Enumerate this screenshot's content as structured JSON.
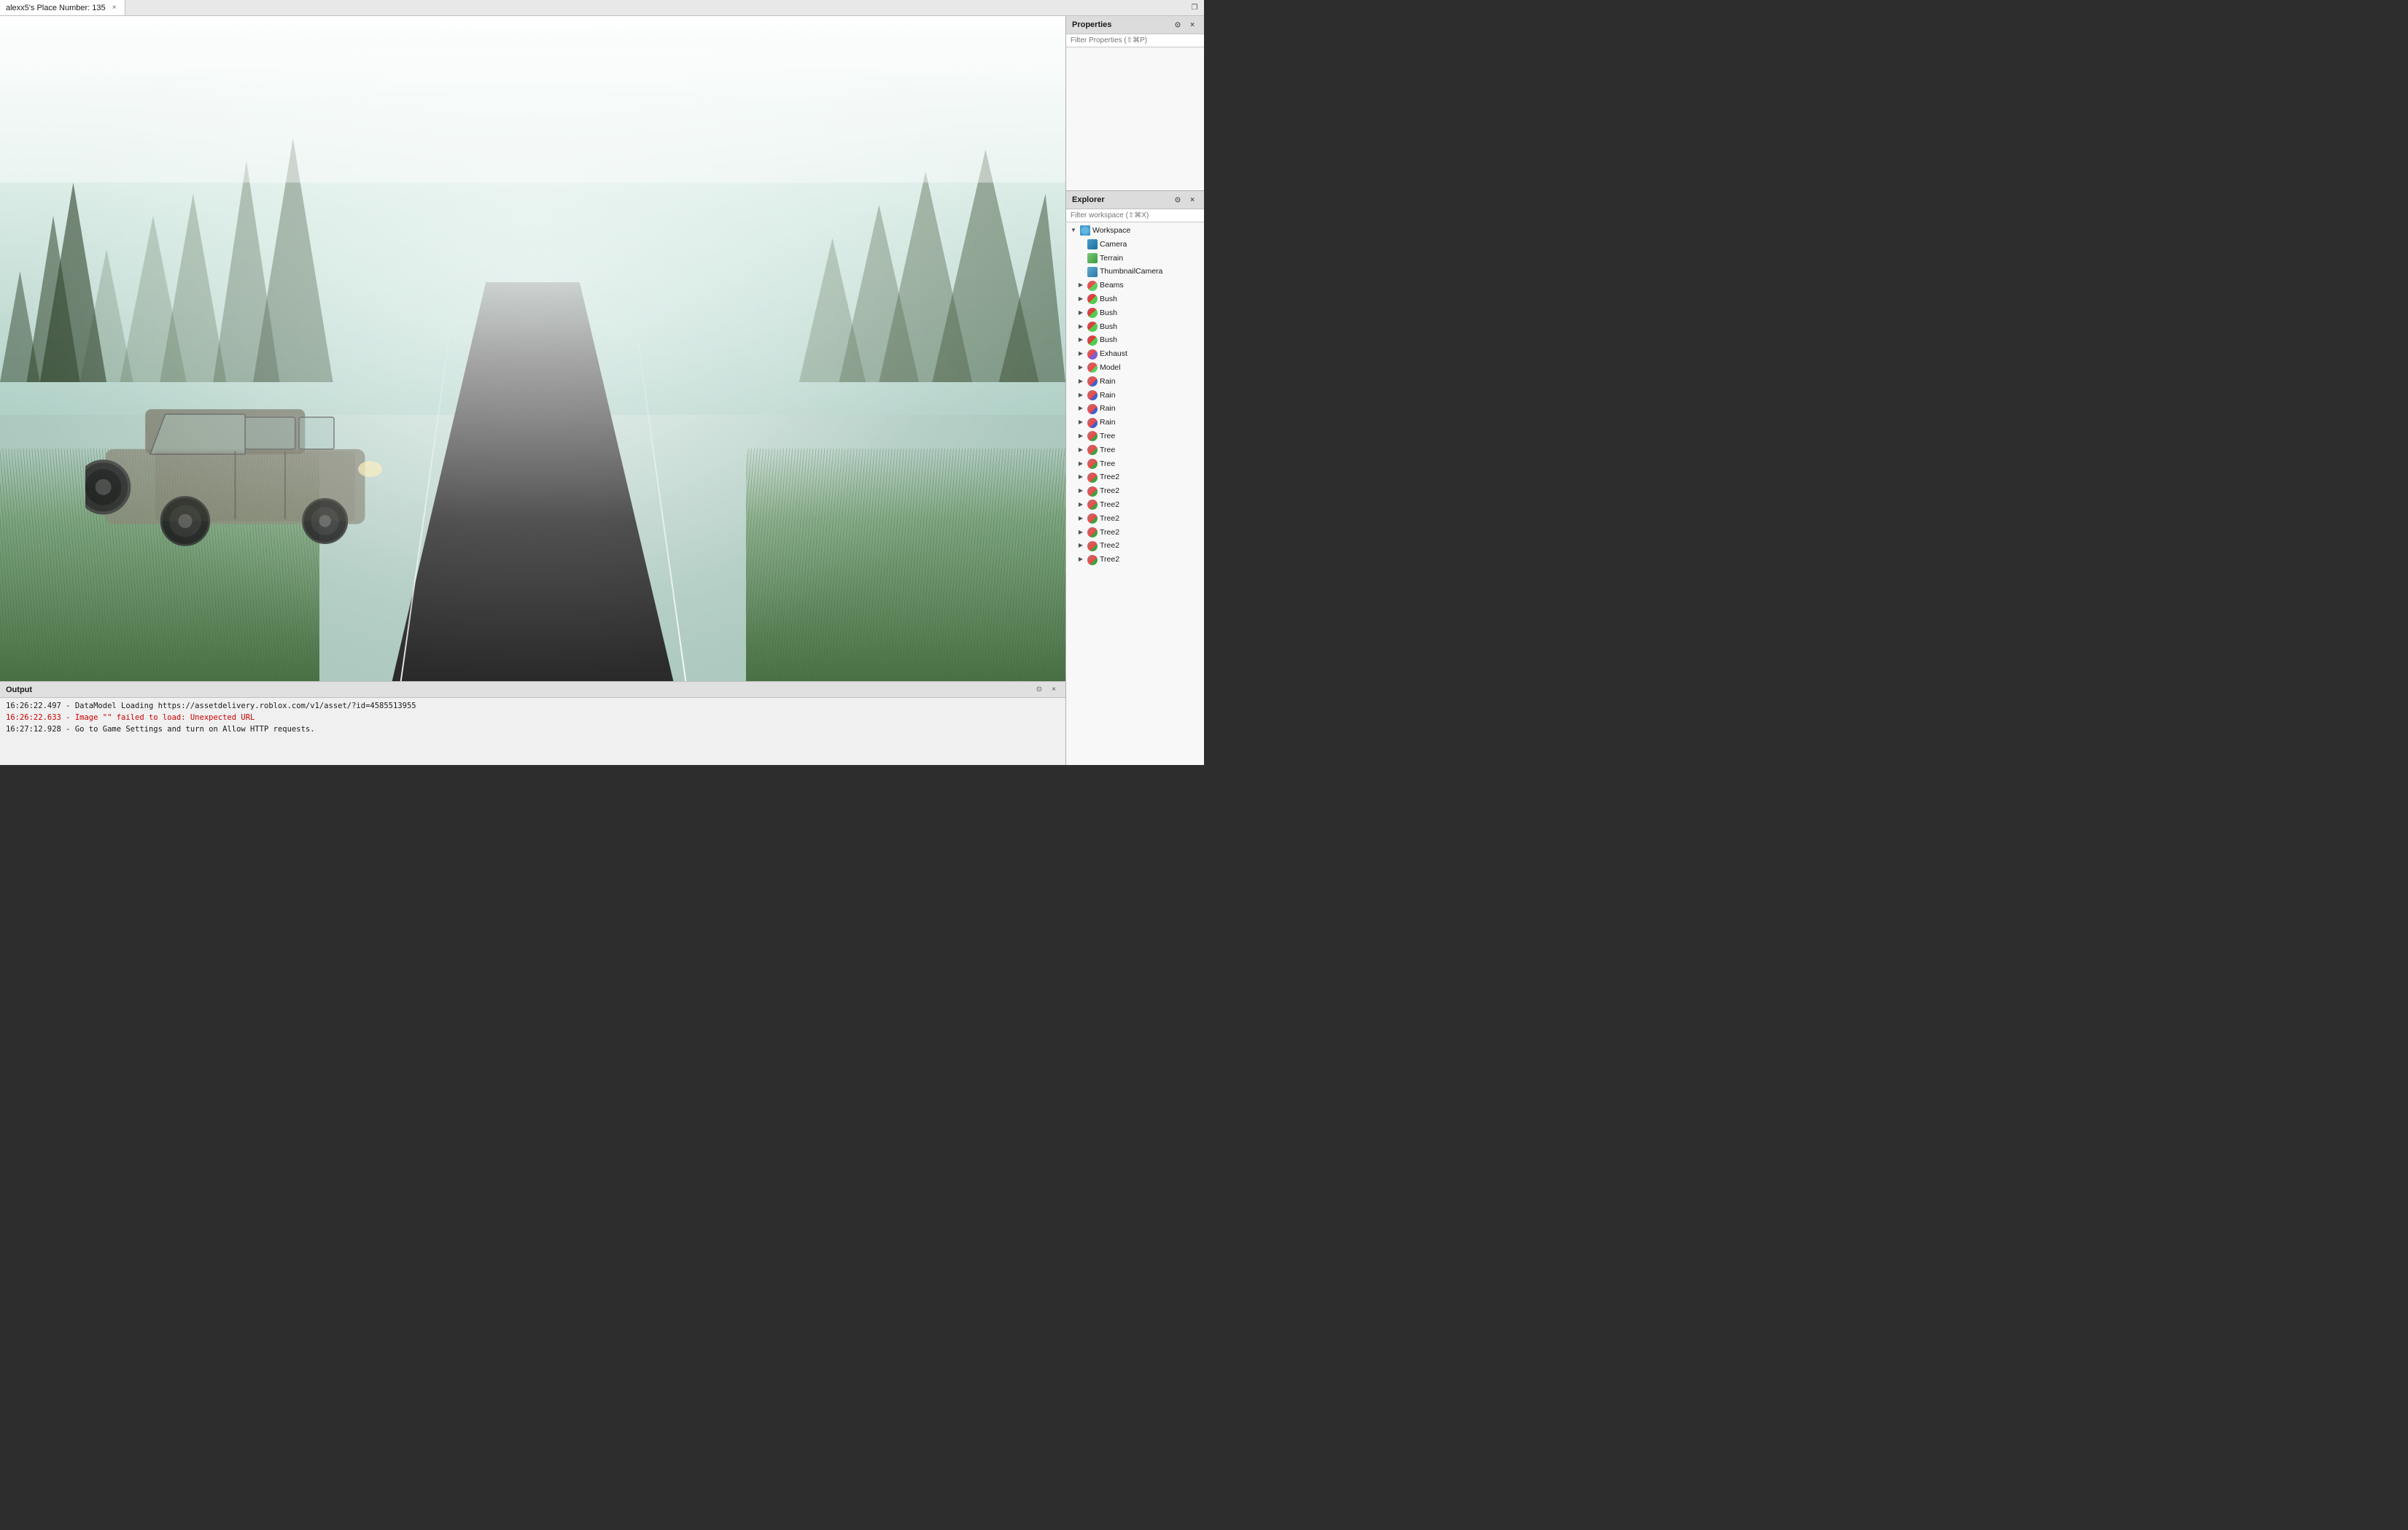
{
  "titlebar": {
    "tab_label": "alexx5's Place Number: 135",
    "close_label": "×",
    "restore_label": "❐"
  },
  "properties_panel": {
    "title": "Properties",
    "filter_placeholder": "Filter Properties (⇧⌘P)",
    "close_icon": "×",
    "settings_icon": "⊙"
  },
  "explorer_panel": {
    "title": "Explorer",
    "filter_placeholder": "Filter workspace (⇧⌘X)",
    "close_icon": "×",
    "settings_icon": "⊙",
    "tree": [
      {
        "id": "workspace",
        "label": "Workspace",
        "icon": "workspace",
        "indent": 0,
        "expanded": true,
        "chevron": "▼"
      },
      {
        "id": "camera",
        "label": "Camera",
        "icon": "camera",
        "indent": 1,
        "expanded": false,
        "chevron": ""
      },
      {
        "id": "terrain",
        "label": "Terrain",
        "icon": "terrain",
        "indent": 1,
        "expanded": false,
        "chevron": ""
      },
      {
        "id": "thumbnailcamera",
        "label": "ThumbnailCamera",
        "icon": "thumbnail",
        "indent": 1,
        "expanded": false,
        "chevron": ""
      },
      {
        "id": "beams",
        "label": "Beams",
        "icon": "beam",
        "indent": 1,
        "expanded": false,
        "chevron": "▶"
      },
      {
        "id": "bush1",
        "label": "Bush",
        "icon": "bush",
        "indent": 1,
        "expanded": false,
        "chevron": "▶"
      },
      {
        "id": "bush2",
        "label": "Bush",
        "icon": "bush",
        "indent": 1,
        "expanded": false,
        "chevron": "▶"
      },
      {
        "id": "bush3",
        "label": "Bush",
        "icon": "bush",
        "indent": 1,
        "expanded": false,
        "chevron": "▶"
      },
      {
        "id": "bush4",
        "label": "Bush",
        "icon": "bush",
        "indent": 1,
        "expanded": false,
        "chevron": "▶"
      },
      {
        "id": "exhaust",
        "label": "Exhaust",
        "icon": "exhaust",
        "indent": 1,
        "expanded": false,
        "chevron": "▶"
      },
      {
        "id": "model",
        "label": "Model",
        "icon": "model",
        "indent": 1,
        "expanded": false,
        "chevron": "▶"
      },
      {
        "id": "rain1",
        "label": "Rain",
        "icon": "rain",
        "indent": 1,
        "expanded": false,
        "chevron": "▶"
      },
      {
        "id": "rain2",
        "label": "Rain",
        "icon": "rain",
        "indent": 1,
        "expanded": false,
        "chevron": "▶"
      },
      {
        "id": "rain3",
        "label": "Rain",
        "icon": "rain",
        "indent": 1,
        "expanded": false,
        "chevron": "▶"
      },
      {
        "id": "rain4",
        "label": "Rain",
        "icon": "rain",
        "indent": 1,
        "expanded": false,
        "chevron": "▶"
      },
      {
        "id": "tree1",
        "label": "Tree",
        "icon": "tree",
        "indent": 1,
        "expanded": false,
        "chevron": "▶"
      },
      {
        "id": "tree2",
        "label": "Tree",
        "icon": "tree",
        "indent": 1,
        "expanded": false,
        "chevron": "▶"
      },
      {
        "id": "tree3",
        "label": "Tree",
        "icon": "tree",
        "indent": 1,
        "expanded": false,
        "chevron": "▶"
      },
      {
        "id": "tree2a",
        "label": "Tree2",
        "icon": "tree",
        "indent": 1,
        "expanded": false,
        "chevron": "▶"
      },
      {
        "id": "tree2b",
        "label": "Tree2",
        "icon": "tree",
        "indent": 1,
        "expanded": false,
        "chevron": "▶"
      },
      {
        "id": "tree2c",
        "label": "Tree2",
        "icon": "tree",
        "indent": 1,
        "expanded": false,
        "chevron": "▶"
      },
      {
        "id": "tree2d",
        "label": "Tree2",
        "icon": "tree",
        "indent": 1,
        "expanded": false,
        "chevron": "▶"
      },
      {
        "id": "tree2e",
        "label": "Tree2",
        "icon": "tree",
        "indent": 1,
        "expanded": false,
        "chevron": "▶"
      },
      {
        "id": "tree2f",
        "label": "Tree2",
        "icon": "tree",
        "indent": 1,
        "expanded": false,
        "chevron": "▶"
      },
      {
        "id": "tree2g",
        "label": "Tree2",
        "icon": "tree",
        "indent": 1,
        "expanded": false,
        "chevron": "▶"
      }
    ]
  },
  "output_panel": {
    "title": "Output",
    "logs": [
      {
        "type": "normal",
        "text": "16:26:22.497 - DataModel Loading https://assetdelivery.roblox.com/v1/asset/?id=4585513955"
      },
      {
        "type": "error",
        "text": "16:26:22.633 - Image \"\" failed to load: Unexpected URL"
      },
      {
        "type": "normal",
        "text": "16:27:12.928 - Go to Game Settings and turn on Allow HTTP requests."
      }
    ]
  }
}
